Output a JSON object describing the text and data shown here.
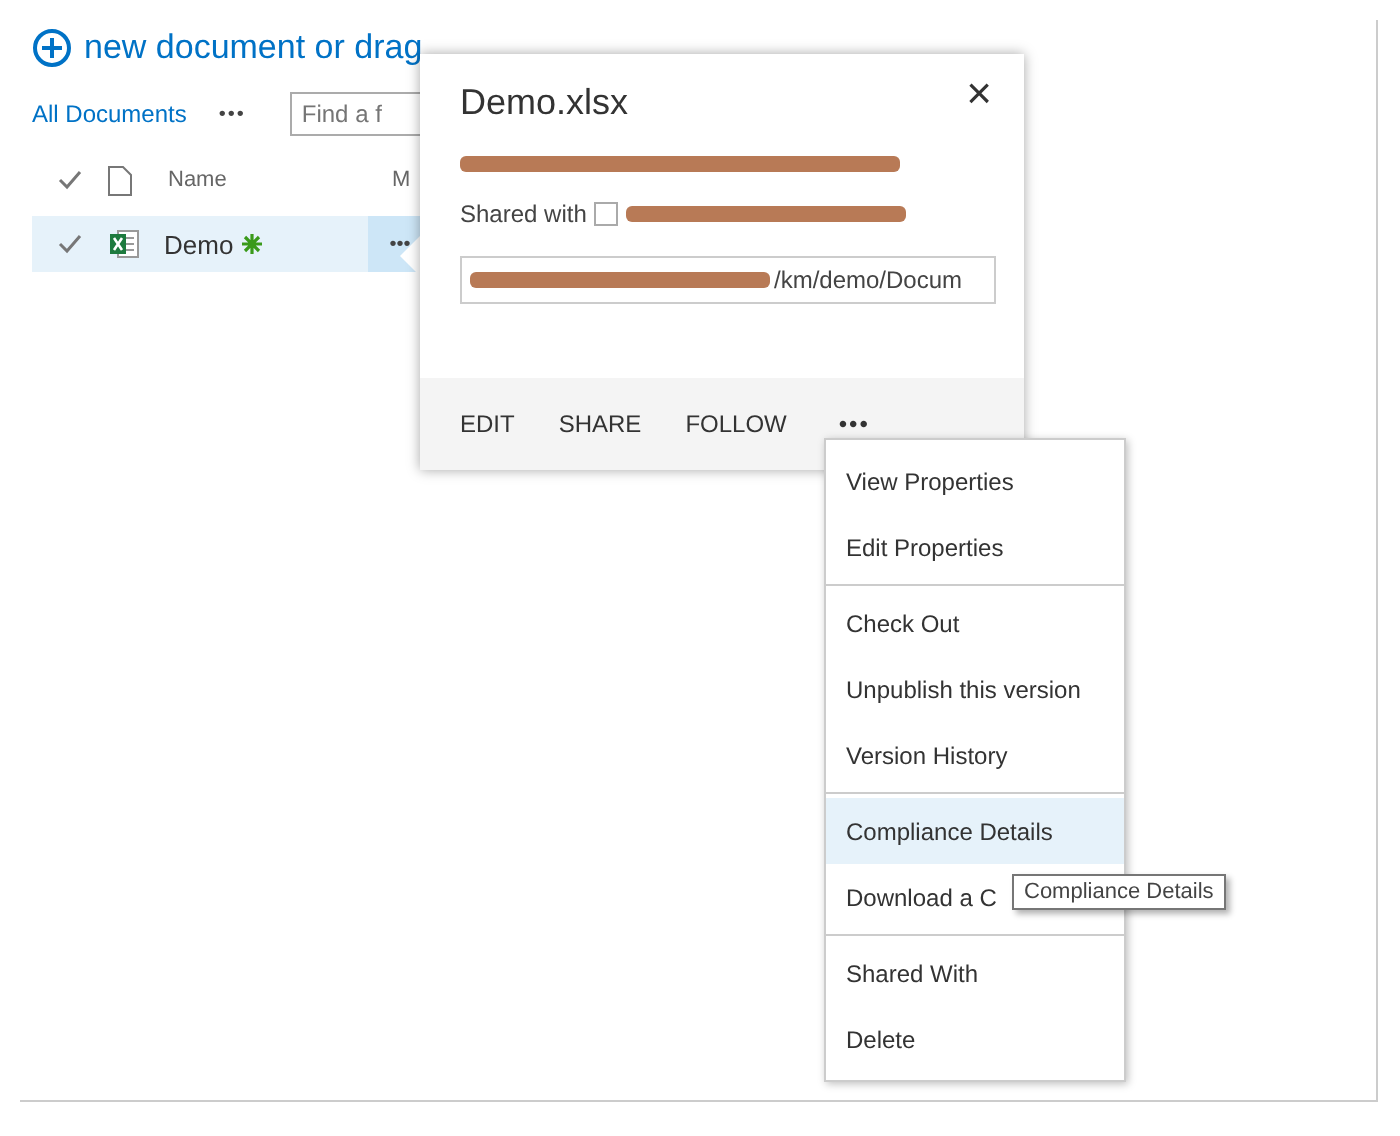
{
  "header": {
    "new_document": "new document or drag"
  },
  "toolbar": {
    "view": "All Documents",
    "more": "•••",
    "search": {
      "placeholder": "Find a f"
    }
  },
  "table": {
    "columns": [
      "Name",
      "M"
    ],
    "rows": [
      {
        "name": "Demo",
        "selected": true,
        "is_new": true,
        "more": "•••"
      }
    ]
  },
  "callout": {
    "title": "Demo.xlsx",
    "close": "×",
    "shared_with": "Shared with",
    "url": "/km/demo/Docum",
    "actions": [
      "EDIT",
      "SHARE",
      "FOLLOW"
    ],
    "more": "•••"
  },
  "menu": {
    "groups": [
      [
        {
          "label": "View Properties",
          "selected": false
        },
        {
          "label": "Edit Properties",
          "selected": false
        }
      ],
      [
        {
          "label": "Check Out",
          "selected": false
        },
        {
          "label": "Unpublish this version",
          "selected": false
        },
        {
          "label": "Version History",
          "selected": false
        }
      ],
      [
        {
          "label": "Compliance Details",
          "selected": true
        },
        {
          "label": "Download a C",
          "selected": false
        }
      ],
      [
        {
          "label": "Shared With",
          "selected": false
        },
        {
          "label": "Delete",
          "selected": false
        }
      ]
    ]
  },
  "tooltip": "Compliance Details"
}
